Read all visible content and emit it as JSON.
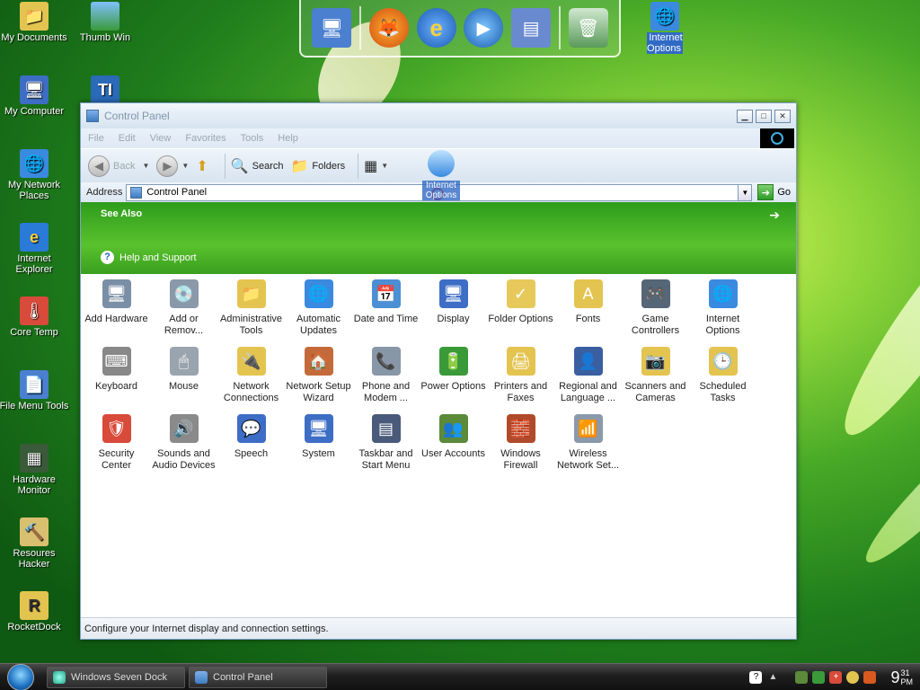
{
  "desktop": {
    "icons": [
      {
        "label": "My Documents"
      },
      {
        "label": "Thumb Win"
      },
      {
        "label": "My Computer"
      },
      {
        "label": "My Network Places"
      },
      {
        "label": "Internet Explorer"
      },
      {
        "label": "Core Temp"
      },
      {
        "label": "File Menu Tools"
      },
      {
        "label": "Hardware Monitor"
      },
      {
        "label": "Resoures Hacker"
      },
      {
        "label": "RocketDock"
      },
      {
        "label": "Internet Options"
      }
    ]
  },
  "dock": {
    "items": [
      "monitor-icon",
      "firefox-icon",
      "ie-icon",
      "media-player-icon",
      "control-panel-icon",
      "recycle-bin-icon"
    ]
  },
  "window": {
    "title": "Control Panel",
    "menu": [
      "File",
      "Edit",
      "View",
      "Favorites",
      "Tools",
      "Help"
    ],
    "toolbar": {
      "back": "Back",
      "search": "Search",
      "folders": "Folders"
    },
    "address": {
      "label": "Address",
      "value": "Control Panel",
      "go": "Go"
    },
    "drag_ghost": "Internet Options",
    "see_also": {
      "heading": "See Also",
      "help_link": "Help and Support"
    },
    "items": [
      {
        "label": "Add Hardware",
        "color": "#7a8fa5",
        "glyph": "🖥"
      },
      {
        "label": "Add or Remov...",
        "color": "#8a99aa",
        "glyph": "💿"
      },
      {
        "label": "Administrative Tools",
        "color": "#e3c450",
        "glyph": "📁"
      },
      {
        "label": "Automatic Updates",
        "color": "#3a8ae0",
        "glyph": "🌐"
      },
      {
        "label": "Date and Time",
        "color": "#4b8fd4",
        "glyph": "📅"
      },
      {
        "label": "Display",
        "color": "#3d6dc4",
        "glyph": "🖥"
      },
      {
        "label": "Folder Options",
        "color": "#e6c95a",
        "glyph": "✓"
      },
      {
        "label": "Fonts",
        "color": "#e3c450",
        "glyph": "A"
      },
      {
        "label": "Game Controllers",
        "color": "#556677",
        "glyph": "🎮"
      },
      {
        "label": "Internet Options",
        "color": "#3a8ae0",
        "glyph": "🌐"
      },
      {
        "label": "Keyboard",
        "color": "#888888",
        "glyph": "⌨"
      },
      {
        "label": "Mouse",
        "color": "#9aa4ae",
        "glyph": "🖱"
      },
      {
        "label": "Network Connections",
        "color": "#e3c450",
        "glyph": "🔌"
      },
      {
        "label": "Network Setup Wizard",
        "color": "#c46a3a",
        "glyph": "🏠"
      },
      {
        "label": "Phone and Modem ...",
        "color": "#8897a8",
        "glyph": "📞"
      },
      {
        "label": "Power Options",
        "color": "#3a9a3a",
        "glyph": "🔋"
      },
      {
        "label": "Printers and Faxes",
        "color": "#e3c450",
        "glyph": "🖨"
      },
      {
        "label": "Regional and Language ...",
        "color": "#3a5fa0",
        "glyph": "👤"
      },
      {
        "label": "Scanners and Cameras",
        "color": "#e3c450",
        "glyph": "📷"
      },
      {
        "label": "Scheduled Tasks",
        "color": "#e3c450",
        "glyph": "🕒"
      },
      {
        "label": "Security Center",
        "color": "#d84a3a",
        "glyph": "🛡"
      },
      {
        "label": "Sounds and Audio Devices",
        "color": "#8a8a8a",
        "glyph": "🔊"
      },
      {
        "label": "Speech",
        "color": "#3d6dc4",
        "glyph": "💬"
      },
      {
        "label": "System",
        "color": "#3d6dc4",
        "glyph": "🖥"
      },
      {
        "label": "Taskbar and Start Menu",
        "color": "#4a5a7a",
        "glyph": "▤"
      },
      {
        "label": "User Accounts",
        "color": "#5a8a3a",
        "glyph": "👥"
      },
      {
        "label": "Windows Firewall",
        "color": "#b04a2a",
        "glyph": "🧱"
      },
      {
        "label": "Wireless Network Set...",
        "color": "#8a9aaa",
        "glyph": "📶"
      }
    ],
    "status": "Configure your Internet display and connection settings."
  },
  "taskbar": {
    "tasks": [
      {
        "label": "Windows Seven Dock"
      },
      {
        "label": "Control Panel"
      }
    ],
    "clock_hour": "9",
    "clock_min": "31",
    "clock_ampm": "PM"
  }
}
